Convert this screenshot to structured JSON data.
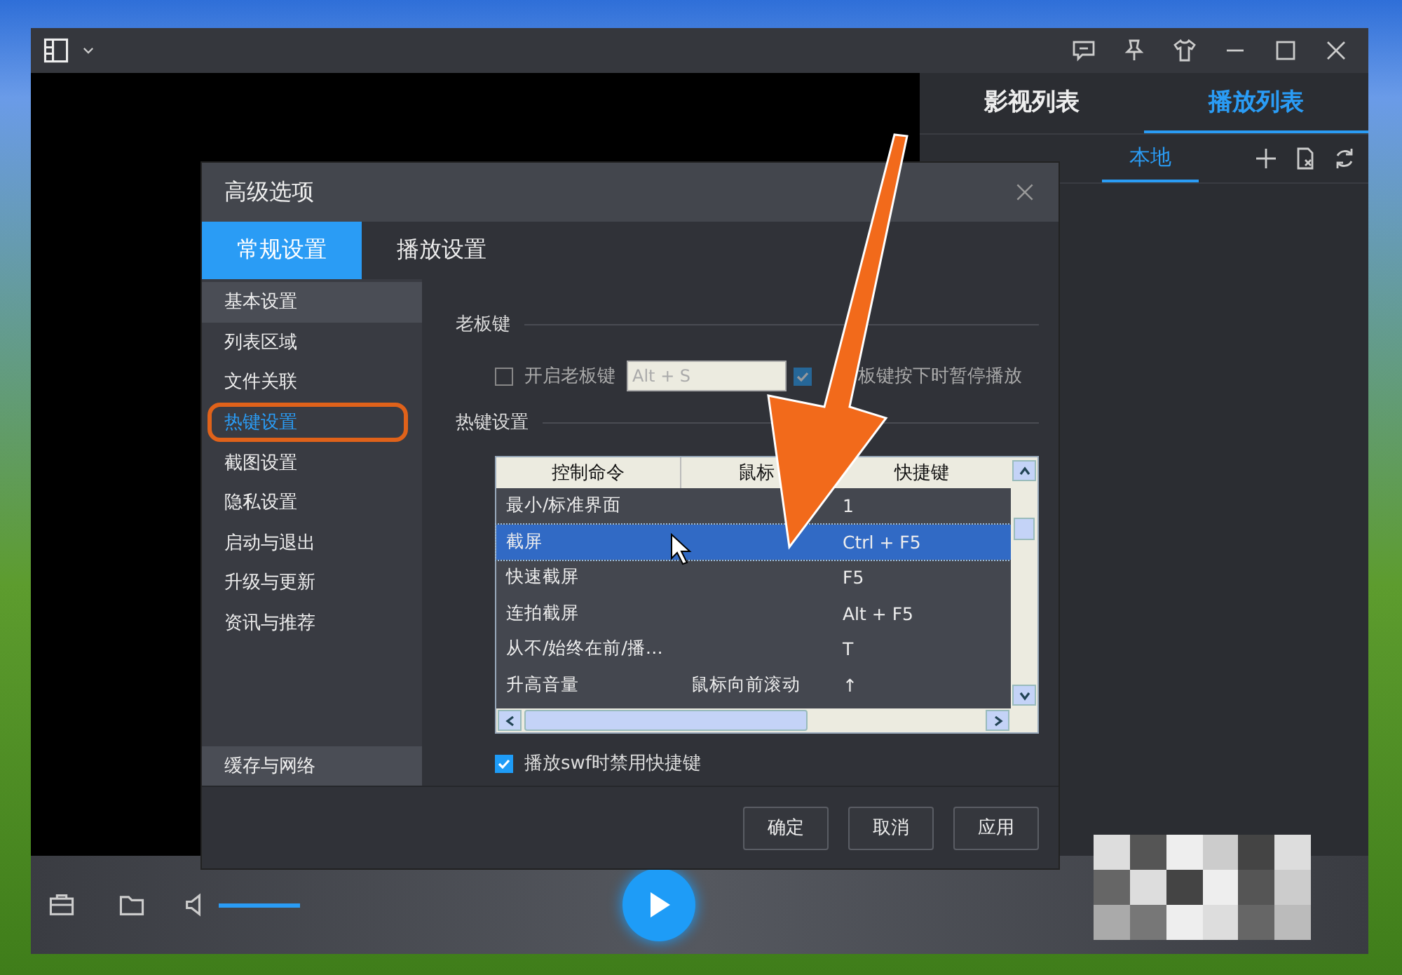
{
  "right_panel": {
    "tabs": [
      {
        "label": "影视列表",
        "selected": false
      },
      {
        "label": "播放列表",
        "selected": true
      }
    ],
    "subtabs": [
      {
        "label": "本地",
        "selected": true
      }
    ]
  },
  "player": {
    "volume": {
      "level": 1
    }
  },
  "dialog": {
    "title": "高级选项",
    "tabs": [
      {
        "label": "常规设置",
        "selected": true
      },
      {
        "label": "播放设置",
        "selected": false
      }
    ],
    "nav": [
      {
        "label": "基本设置",
        "hovered": true,
        "selected": false
      },
      {
        "label": "列表区域",
        "hovered": false,
        "selected": false
      },
      {
        "label": "文件关联",
        "hovered": false,
        "selected": false
      },
      {
        "label": "热键设置",
        "hovered": false,
        "selected": true
      },
      {
        "label": "截图设置",
        "hovered": false,
        "selected": false
      },
      {
        "label": "隐私设置",
        "hovered": false,
        "selected": false
      },
      {
        "label": "启动与退出",
        "hovered": false,
        "selected": false
      },
      {
        "label": "升级与更新",
        "hovered": false,
        "selected": false
      },
      {
        "label": "资讯与推荐",
        "hovered": false,
        "selected": false
      }
    ],
    "nav_bottom": {
      "label": "缓存与网络"
    },
    "boss_key": {
      "heading": "老板键",
      "enable": {
        "label": "开启老板键",
        "checked": false
      },
      "hotkey_field": {
        "value": "Alt + S"
      },
      "pause": {
        "label": "板键按下时暂停播放",
        "checked": true
      }
    },
    "hotkeys": {
      "heading": "热键设置",
      "columns": [
        "控制命令",
        "鼠标",
        "快捷键"
      ],
      "rows": [
        {
          "cells": [
            "最小/标准界面",
            "",
            "1"
          ],
          "selected": false
        },
        {
          "cells": [
            "截屏",
            "",
            "Ctrl + F5"
          ],
          "selected": true
        },
        {
          "cells": [
            "快速截屏",
            "",
            "F5"
          ],
          "selected": false
        },
        {
          "cells": [
            "连拍截屏",
            "",
            "Alt + F5"
          ],
          "selected": false
        },
        {
          "cells": [
            "从不/始终在前/播…",
            "",
            "T"
          ],
          "selected": false
        },
        {
          "cells": [
            "升高音量",
            "鼠标向前滚动",
            "↑"
          ],
          "selected": false
        }
      ]
    },
    "disable_swf": {
      "label": "播放swf时禁用快捷键",
      "checked": true
    },
    "buttons": [
      "确定",
      "取消",
      "应用"
    ]
  }
}
